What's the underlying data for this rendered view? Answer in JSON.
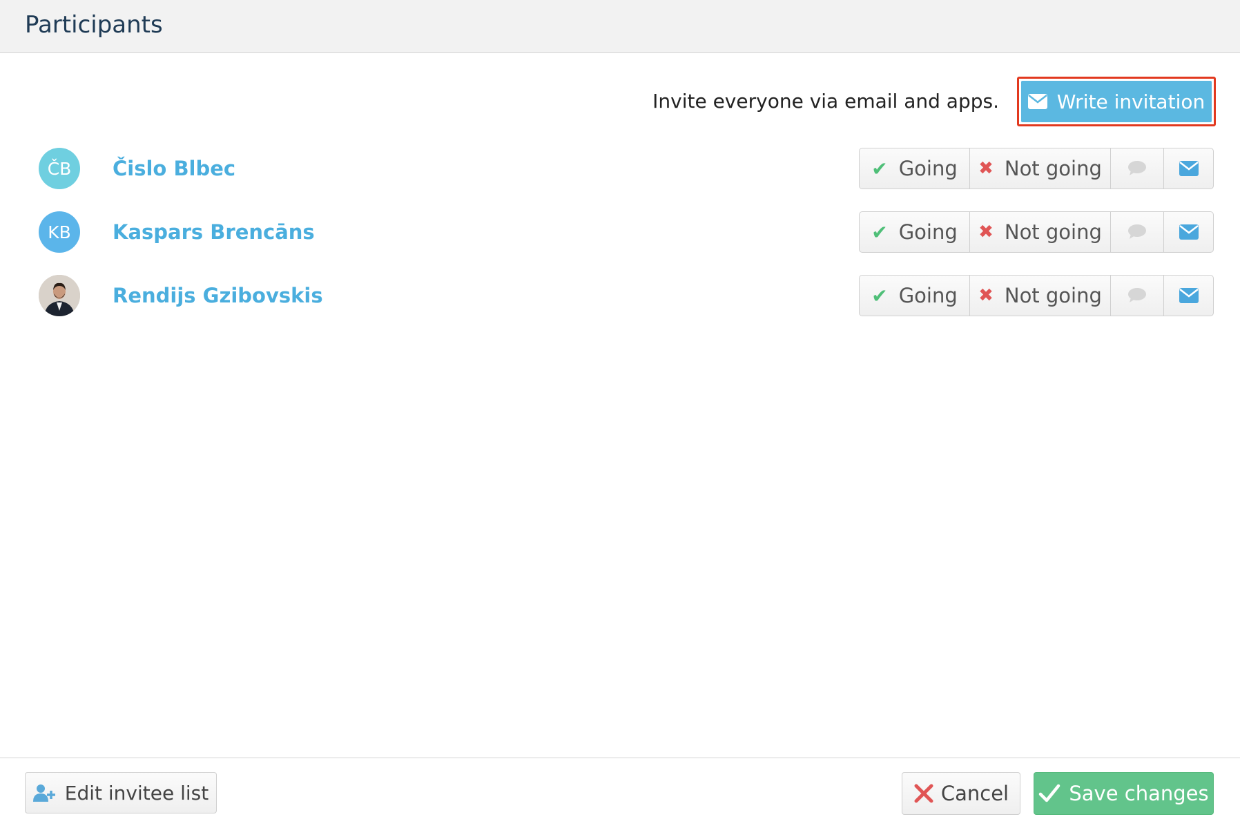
{
  "header": {
    "title": "Participants"
  },
  "invite": {
    "text": "Invite everyone via email and apps.",
    "button_label": "Write invitation",
    "button_icon": "envelope-icon"
  },
  "participants": [
    {
      "initials": "ČB",
      "name": "Čislo Blbec",
      "avatar_type": "initials",
      "avatar_color": "#6fcfe0"
    },
    {
      "initials": "KB",
      "name": "Kaspars Brencāns",
      "avatar_type": "initials",
      "avatar_color": "#5bb5ea"
    },
    {
      "initials": "",
      "name": "Rendijs Gzibovskis",
      "avatar_type": "photo",
      "avatar_color": "#cfc6bd"
    }
  ],
  "rsvp": {
    "going_label": "Going",
    "not_going_label": "Not going",
    "going_icon": "check-icon",
    "not_going_icon": "x-icon",
    "comment_icon": "speech-bubble-icon",
    "mail_icon": "envelope-icon"
  },
  "footer": {
    "edit_label": "Edit invitee list",
    "cancel_label": "Cancel",
    "save_label": "Save changes"
  },
  "colors": {
    "accent_blue": "#5bb8e1",
    "name_blue": "#4aaede",
    "success_green": "#62c48b",
    "danger_red": "#e05555",
    "highlight_border": "#e2391f"
  }
}
